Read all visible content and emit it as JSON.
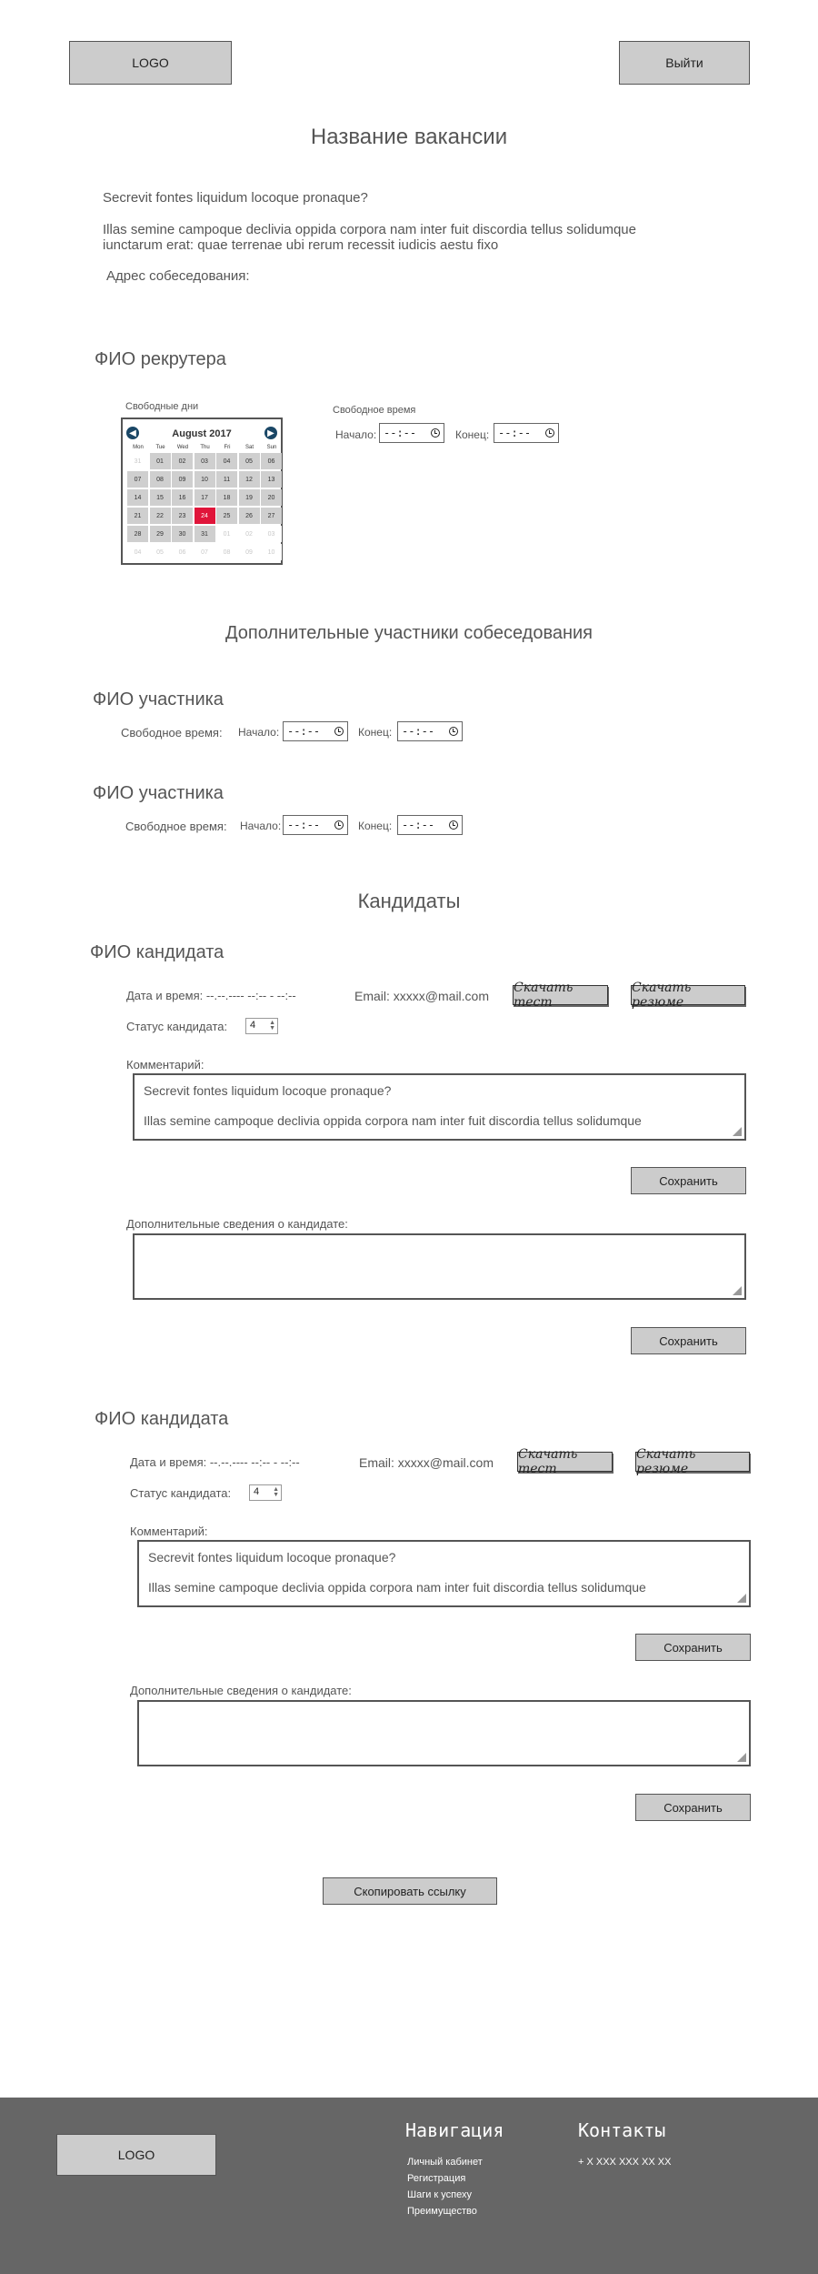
{
  "header": {
    "logo": "LOGO",
    "logout": "Выйти"
  },
  "vacancy": {
    "title": "Название вакансии",
    "question": "Secrevit fontes liquidum locoque pronaque?",
    "desc_line1": "Illas semine campoque declivia oppida corpora nam inter fuit discordia tellus solidumque",
    "desc_line2": "iunctarum erat: quae terrenae ubi rerum recessit iudicis aestu fixo",
    "address_label": "Адрес собеседования:"
  },
  "recruiter": {
    "name": "ФИО рекрутера",
    "free_days_label": "Свободные дни",
    "free_time_label": "Свободное время",
    "start_label": "Начало:",
    "end_label": "Конец:",
    "time_placeholder": "--:--"
  },
  "calendar": {
    "month": "August 2017",
    "weekdays": [
      "Mon",
      "Tue",
      "Wed",
      "Thu",
      "Fri",
      "Sat",
      "Sun"
    ],
    "weeks": [
      [
        "31",
        "01",
        "02",
        "03",
        "04",
        "05",
        "06"
      ],
      [
        "07",
        "08",
        "09",
        "10",
        "11",
        "12",
        "13"
      ],
      [
        "14",
        "15",
        "16",
        "17",
        "18",
        "19",
        "20"
      ],
      [
        "21",
        "22",
        "23",
        "24",
        "25",
        "26",
        "27"
      ],
      [
        "28",
        "29",
        "30",
        "31",
        "01",
        "02",
        "03"
      ],
      [
        "04",
        "05",
        "06",
        "07",
        "08",
        "09",
        "10"
      ]
    ],
    "selected": "24"
  },
  "participants": {
    "title": "Дополнительные участники собеседования",
    "items": [
      {
        "name": "ФИО участника",
        "free_time_label": "Свободное время:",
        "start_label": "Начало:",
        "end_label": "Конец:"
      },
      {
        "name": "ФИО участника",
        "free_time_label": "Свободное время:",
        "start_label": "Начало:",
        "end_label": "Конец:"
      }
    ]
  },
  "candidates": {
    "title": "Кандидаты",
    "items": [
      {
        "name": "ФИО кандидата",
        "datetime": "Дата и время: --.--.---- --:-- - --:--",
        "email": "Email: xxxxx@mail.com",
        "download_test": "Скачать тест",
        "download_resume": "Скачать резюме",
        "status_label": "Статус кандидата:",
        "status_value": "4",
        "comment_label": "Комментарий:",
        "comment_line1": "Secrevit fontes liquidum locoque pronaque?",
        "comment_line2": "Illas semine campoque declivia oppida corpora nam inter fuit discordia tellus solidumque",
        "save1": "Сохранить",
        "extra_label": "Дополнительные сведения о кандидате:",
        "save2": "Сохранить"
      },
      {
        "name": "ФИО кандидата",
        "datetime": "Дата и время: --.--.---- --:-- - --:--",
        "email": "Email: xxxxx@mail.com",
        "download_test": "Скачать тест",
        "download_resume": "Скачать резюме",
        "status_label": "Статус кандидата:",
        "status_value": "4",
        "comment_label": "Комментарий:",
        "comment_line1": "Secrevit fontes liquidum locoque pronaque?",
        "comment_line2": "Illas semine campoque declivia oppida corpora nam inter fuit discordia tellus solidumque",
        "save1": "Сохранить",
        "extra_label": "Дополнительные сведения о кандидате:",
        "save2": "Сохранить"
      }
    ]
  },
  "copy_link": "Скопировать ссылку",
  "footer": {
    "logo": "LOGO",
    "nav_title": "Навигация",
    "nav_links": [
      "Личный кабинет",
      "Регистрация",
      "Шаги к успеху",
      "Преимущество"
    ],
    "contacts_title": "Контакты",
    "phone": "+ X XXX XXX XX XX"
  }
}
